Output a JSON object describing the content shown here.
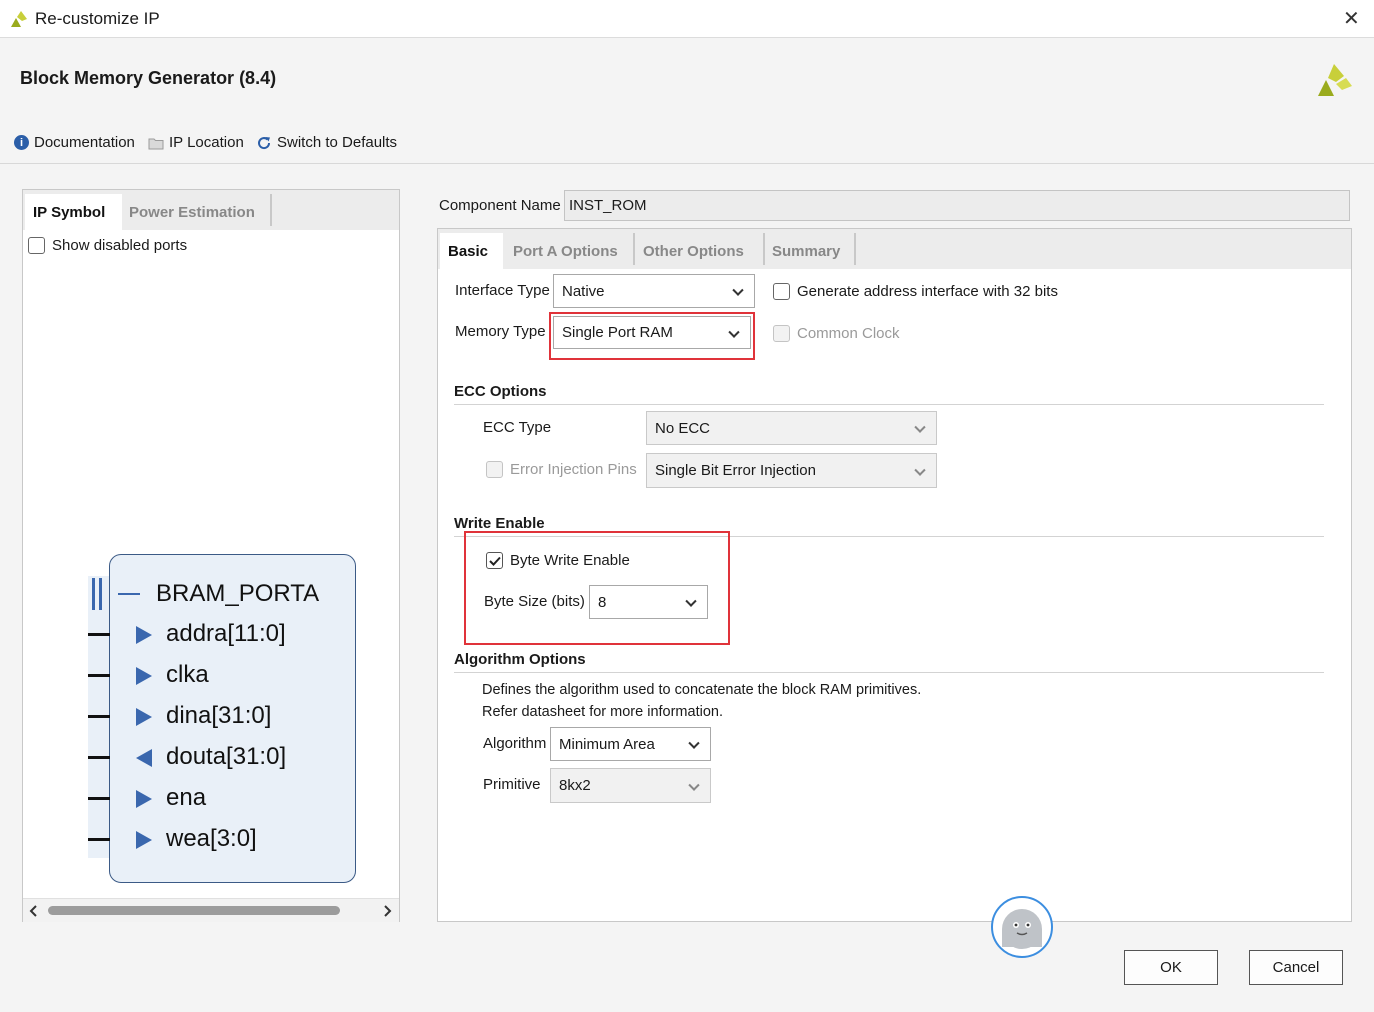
{
  "window": {
    "title": "Re-customize IP",
    "close_glyph": "✕"
  },
  "header": {
    "title": "Block Memory Generator (8.4)",
    "toolbar": {
      "documentation": "Documentation",
      "ip_location": "IP Location",
      "switch_defaults": "Switch to Defaults"
    }
  },
  "left_panel": {
    "tabs": [
      "IP Symbol",
      "Power Estimation"
    ],
    "active_tab": "IP Symbol",
    "show_disabled_ports": "Show disabled ports",
    "symbol": {
      "bus": "BRAM_PORTA",
      "ports": [
        {
          "name": "addra[11:0]",
          "dir": "in"
        },
        {
          "name": "clka",
          "dir": "in"
        },
        {
          "name": "dina[31:0]",
          "dir": "in"
        },
        {
          "name": "douta[31:0]",
          "dir": "out"
        },
        {
          "name": "ena",
          "dir": "in"
        },
        {
          "name": "wea[3:0]",
          "dir": "in"
        }
      ]
    }
  },
  "right_panel": {
    "component_name_label": "Component Name",
    "component_name_value": "INST_ROM",
    "tabs": [
      "Basic",
      "Port A Options",
      "Other Options",
      "Summary"
    ],
    "active_tab": "Basic",
    "interface_type_label": "Interface Type",
    "interface_type_value": "Native",
    "memory_type_label": "Memory Type",
    "memory_type_value": "Single Port RAM",
    "generate_addr_32": "Generate address interface with 32 bits",
    "common_clock": "Common Clock",
    "ecc": {
      "section": "ECC Options",
      "type_label": "ECC Type",
      "type_value": "No ECC",
      "error_injection_label": "Error Injection Pins",
      "error_injection_value": "Single Bit Error Injection"
    },
    "write_enable": {
      "section": "Write Enable",
      "byte_write_enable": "Byte Write Enable",
      "byte_write_enable_checked": true,
      "byte_size_label": "Byte Size (bits)",
      "byte_size_value": "8"
    },
    "algorithm": {
      "section": "Algorithm Options",
      "desc1": "Defines the algorithm used to concatenate the block RAM primitives.",
      "desc2": "Refer datasheet for more information.",
      "algorithm_label": "Algorithm",
      "algorithm_value": "Minimum Area",
      "primitive_label": "Primitive",
      "primitive_value": "8kx2"
    }
  },
  "buttons": {
    "ok": "OK",
    "cancel": "Cancel"
  },
  "colors": {
    "highlight": "#e0333a",
    "symbol_fill": "#e9f0f8",
    "port_arrow": "#3a67ae",
    "brand": "#9aab1d"
  },
  "icons": [
    "xilinx-logo-icon",
    "info-icon",
    "folder-icon",
    "refresh-icon",
    "close-icon",
    "checkmark-icon",
    "mascot-icon"
  ]
}
